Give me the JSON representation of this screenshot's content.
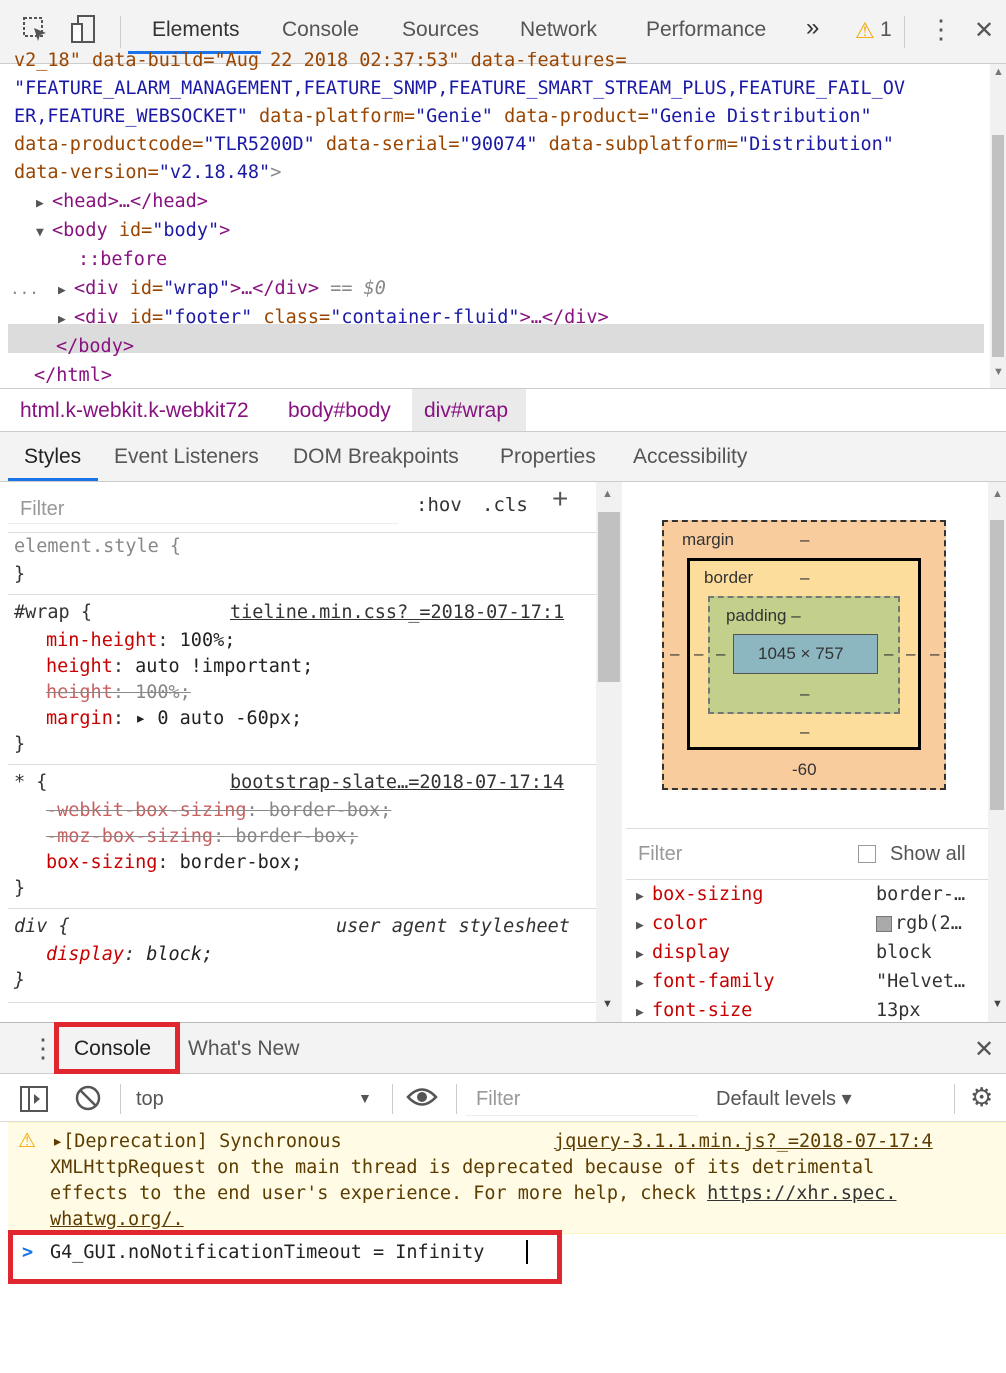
{
  "toolbar": {
    "tabs": [
      "Elements",
      "Console",
      "Sources",
      "Network",
      "Performance"
    ],
    "more": "»",
    "warning_count": "1",
    "kebab": "⋮",
    "close": "✕"
  },
  "dom": {
    "line0": "v2_18\" data-build=\"Aug 22 2018 02:37:53\" data-features=",
    "line1": "\"FEATURE_ALARM_MANAGEMENT,FEATURE_SNMP,FEATURE_SMART_STREAM_PLUS,FEATURE_FAIL_OV",
    "line2a": "ER,FEATURE_WEBSOCKET\"",
    "line2b": " data-platform=",
    "line2c": "\"Genie\"",
    "line2d": " data-product=",
    "line2e": "\"Genie Distribution\"",
    "line3a": "data-productcode=",
    "line3b": "\"TLR5200D\"",
    "line3c": " data-serial=",
    "line3d": "\"90074\"",
    "line3e": " data-subplatform=",
    "line3f": "\"Distribution\"",
    "line4a": "data-version=",
    "line4b": "\"v2.18.48\"",
    "line4c": ">",
    "head": "<head>…</head>",
    "body_open_a": "<body",
    "body_open_b": " id=",
    "body_open_c": "\"body\"",
    "body_open_d": ">",
    "before": "::before",
    "wrap_a": "<div",
    "wrap_b": " id=",
    "wrap_c": "\"wrap\"",
    "wrap_d": ">…</div>",
    "wrap_e": " == $0",
    "ellipsis": "...",
    "footer_a": "<div",
    "footer_b": " id=",
    "footer_c": "\"footer\"",
    "footer_d": " class=",
    "footer_e": "\"container-fluid\"",
    "footer_f": ">…</div>",
    "body_close": "</body>",
    "html_close": "</html>"
  },
  "breadcrumbs": [
    "html.k-webkit.k-webkit72",
    "body#body",
    "div#wrap"
  ],
  "side_tabs": [
    "Styles",
    "Event Listeners",
    "DOM Breakpoints",
    "Properties",
    "Accessibility"
  ],
  "styles": {
    "filter_placeholder": "Filter",
    "hov": ":hov",
    "cls": ".cls",
    "plus": "+",
    "element_style": "element.style {",
    "close_brace": "}",
    "wrap_selector": "#wrap {",
    "wrap_source": "tieline.min.css?_=2018-07-17:1",
    "wrap_props": [
      {
        "prop": "min-height",
        "val": "100%;"
      },
      {
        "prop": "height",
        "val": "auto !important;"
      },
      {
        "prop": "height",
        "val": "100%;"
      },
      {
        "prop": "margin",
        "val": "▸ 0 auto -60px;"
      }
    ],
    "star_selector": "* {",
    "star_source": "bootstrap-slate…=2018-07-17:14",
    "star_props": [
      {
        "prop": "-webkit-box-sizing",
        "val": "border-box;"
      },
      {
        "prop": "-moz-box-sizing",
        "val": "border-box;"
      },
      {
        "prop": "box-sizing",
        "val": "border-box;"
      }
    ],
    "div_selector": "div {",
    "div_source": "user agent stylesheet",
    "div_props": [
      {
        "prop": "display",
        "val": "block;"
      }
    ]
  },
  "box_model": {
    "margin_label": "margin",
    "margin_top": "–",
    "margin_bottom": "-60",
    "margin_left": "–",
    "margin_right": "–",
    "border_label": "border",
    "border_top": "–",
    "border_bottom": "–",
    "border_left": "–",
    "border_right": "–",
    "padding_label": "padding –",
    "padding_bottom": "–",
    "padding_left": "–",
    "padding_right": "–",
    "content": "1045 × 757"
  },
  "computed": {
    "filter_placeholder": "Filter",
    "show_all": "Show all",
    "rows": [
      {
        "prop": "box-sizing",
        "val": "border-…"
      },
      {
        "prop": "color",
        "val": "rgb(2…"
      },
      {
        "prop": "display",
        "val": "block"
      },
      {
        "prop": "font-family",
        "val": "\"Helvet…"
      },
      {
        "prop": "font-size",
        "val": "13px"
      }
    ]
  },
  "drawer": {
    "tabs": [
      "Console",
      "What's New"
    ],
    "close": "✕",
    "context": "top",
    "filter_placeholder": "Filter",
    "levels": "Default levels ▾"
  },
  "console": {
    "warn_line1": "▸[Deprecation] Synchronous",
    "warn_source": "jquery-3.1.1.min.js?_=2018-07-17:4",
    "warn_line2": "XMLHttpRequest on the main thread is deprecated because of its detrimental",
    "warn_line3a": "effects to the end user's experience. For more help, check ",
    "warn_link": "https://xhr.spec.",
    "warn_line4": "whatwg.org/.",
    "prompt_symbol": ">",
    "input": "G4_GUI.noNotificationTimeout = Infinity"
  },
  "colors": {
    "highlight_box": "#e0262f",
    "warning_bg": "#fffbe5",
    "tab_underline": "#1a73e8"
  }
}
